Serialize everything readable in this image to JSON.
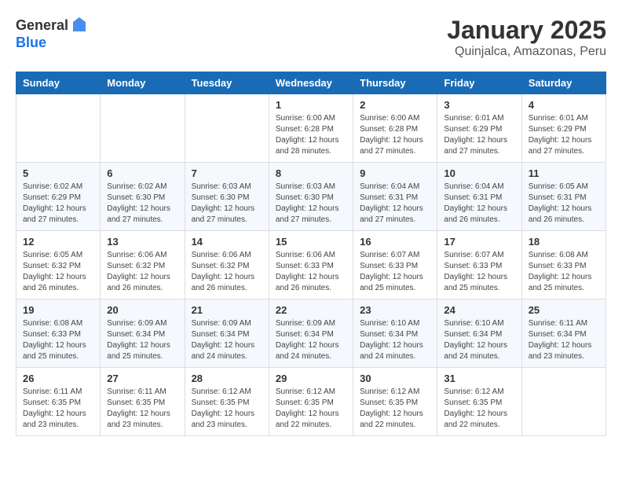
{
  "header": {
    "logo_general": "General",
    "logo_blue": "Blue",
    "month_year": "January 2025",
    "location": "Quinjalca, Amazonas, Peru"
  },
  "calendar": {
    "days_of_week": [
      "Sunday",
      "Monday",
      "Tuesday",
      "Wednesday",
      "Thursday",
      "Friday",
      "Saturday"
    ],
    "weeks": [
      [
        {
          "day": "",
          "info": ""
        },
        {
          "day": "",
          "info": ""
        },
        {
          "day": "",
          "info": ""
        },
        {
          "day": "1",
          "info": "Sunrise: 6:00 AM\nSunset: 6:28 PM\nDaylight: 12 hours and 28 minutes."
        },
        {
          "day": "2",
          "info": "Sunrise: 6:00 AM\nSunset: 6:28 PM\nDaylight: 12 hours and 27 minutes."
        },
        {
          "day": "3",
          "info": "Sunrise: 6:01 AM\nSunset: 6:29 PM\nDaylight: 12 hours and 27 minutes."
        },
        {
          "day": "4",
          "info": "Sunrise: 6:01 AM\nSunset: 6:29 PM\nDaylight: 12 hours and 27 minutes."
        }
      ],
      [
        {
          "day": "5",
          "info": "Sunrise: 6:02 AM\nSunset: 6:29 PM\nDaylight: 12 hours and 27 minutes."
        },
        {
          "day": "6",
          "info": "Sunrise: 6:02 AM\nSunset: 6:30 PM\nDaylight: 12 hours and 27 minutes."
        },
        {
          "day": "7",
          "info": "Sunrise: 6:03 AM\nSunset: 6:30 PM\nDaylight: 12 hours and 27 minutes."
        },
        {
          "day": "8",
          "info": "Sunrise: 6:03 AM\nSunset: 6:30 PM\nDaylight: 12 hours and 27 minutes."
        },
        {
          "day": "9",
          "info": "Sunrise: 6:04 AM\nSunset: 6:31 PM\nDaylight: 12 hours and 27 minutes."
        },
        {
          "day": "10",
          "info": "Sunrise: 6:04 AM\nSunset: 6:31 PM\nDaylight: 12 hours and 26 minutes."
        },
        {
          "day": "11",
          "info": "Sunrise: 6:05 AM\nSunset: 6:31 PM\nDaylight: 12 hours and 26 minutes."
        }
      ],
      [
        {
          "day": "12",
          "info": "Sunrise: 6:05 AM\nSunset: 6:32 PM\nDaylight: 12 hours and 26 minutes."
        },
        {
          "day": "13",
          "info": "Sunrise: 6:06 AM\nSunset: 6:32 PM\nDaylight: 12 hours and 26 minutes."
        },
        {
          "day": "14",
          "info": "Sunrise: 6:06 AM\nSunset: 6:32 PM\nDaylight: 12 hours and 26 minutes."
        },
        {
          "day": "15",
          "info": "Sunrise: 6:06 AM\nSunset: 6:33 PM\nDaylight: 12 hours and 26 minutes."
        },
        {
          "day": "16",
          "info": "Sunrise: 6:07 AM\nSunset: 6:33 PM\nDaylight: 12 hours and 25 minutes."
        },
        {
          "day": "17",
          "info": "Sunrise: 6:07 AM\nSunset: 6:33 PM\nDaylight: 12 hours and 25 minutes."
        },
        {
          "day": "18",
          "info": "Sunrise: 6:08 AM\nSunset: 6:33 PM\nDaylight: 12 hours and 25 minutes."
        }
      ],
      [
        {
          "day": "19",
          "info": "Sunrise: 6:08 AM\nSunset: 6:33 PM\nDaylight: 12 hours and 25 minutes."
        },
        {
          "day": "20",
          "info": "Sunrise: 6:09 AM\nSunset: 6:34 PM\nDaylight: 12 hours and 25 minutes."
        },
        {
          "day": "21",
          "info": "Sunrise: 6:09 AM\nSunset: 6:34 PM\nDaylight: 12 hours and 24 minutes."
        },
        {
          "day": "22",
          "info": "Sunrise: 6:09 AM\nSunset: 6:34 PM\nDaylight: 12 hours and 24 minutes."
        },
        {
          "day": "23",
          "info": "Sunrise: 6:10 AM\nSunset: 6:34 PM\nDaylight: 12 hours and 24 minutes."
        },
        {
          "day": "24",
          "info": "Sunrise: 6:10 AM\nSunset: 6:34 PM\nDaylight: 12 hours and 24 minutes."
        },
        {
          "day": "25",
          "info": "Sunrise: 6:11 AM\nSunset: 6:34 PM\nDaylight: 12 hours and 23 minutes."
        }
      ],
      [
        {
          "day": "26",
          "info": "Sunrise: 6:11 AM\nSunset: 6:35 PM\nDaylight: 12 hours and 23 minutes."
        },
        {
          "day": "27",
          "info": "Sunrise: 6:11 AM\nSunset: 6:35 PM\nDaylight: 12 hours and 23 minutes."
        },
        {
          "day": "28",
          "info": "Sunrise: 6:12 AM\nSunset: 6:35 PM\nDaylight: 12 hours and 23 minutes."
        },
        {
          "day": "29",
          "info": "Sunrise: 6:12 AM\nSunset: 6:35 PM\nDaylight: 12 hours and 22 minutes."
        },
        {
          "day": "30",
          "info": "Sunrise: 6:12 AM\nSunset: 6:35 PM\nDaylight: 12 hours and 22 minutes."
        },
        {
          "day": "31",
          "info": "Sunrise: 6:12 AM\nSunset: 6:35 PM\nDaylight: 12 hours and 22 minutes."
        },
        {
          "day": "",
          "info": ""
        }
      ]
    ]
  }
}
